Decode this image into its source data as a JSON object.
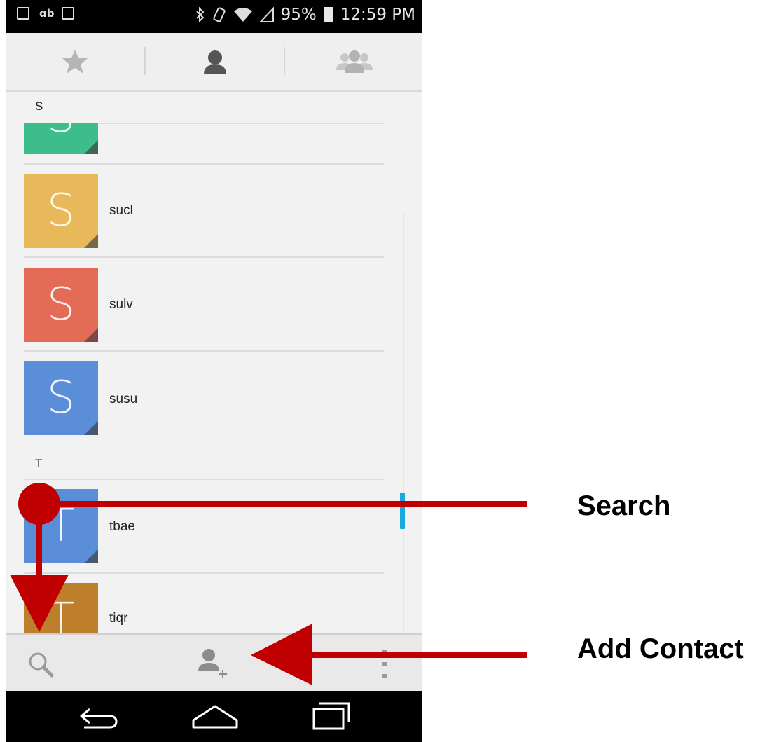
{
  "status_bar": {
    "battery_percent": "95%",
    "time": "12:59 PM",
    "left_icons": [
      "image-notification-icon",
      "dropbox-icon",
      "gmail-icon"
    ],
    "right_icons": [
      "bluetooth-icon",
      "rotation-icon",
      "wifi-icon",
      "signal-icon",
      "battery-icon"
    ]
  },
  "tabs": [
    {
      "id": "favorites",
      "icon": "star-icon",
      "selected": false
    },
    {
      "id": "contacts",
      "icon": "person-icon",
      "selected": true
    },
    {
      "id": "groups",
      "icon": "group-icon",
      "selected": false
    }
  ],
  "contacts": {
    "section_s": "S",
    "section_t": "T",
    "items": [
      {
        "name": "",
        "letter": "S",
        "color": "#3dbd8a"
      },
      {
        "name": "sucl",
        "letter": "S",
        "color": "#e8b95a"
      },
      {
        "name": "sulv",
        "letter": "S",
        "color": "#e46c57"
      },
      {
        "name": "susu",
        "letter": "S",
        "color": "#5b8ed8"
      },
      {
        "name": "tbae",
        "letter": "T",
        "color": "#5b8ed8"
      },
      {
        "name": "tiqr",
        "letter": "T",
        "color": "#bd7f2b"
      }
    ]
  },
  "bottom_bar": {
    "icons": [
      "search-icon",
      "add-contact-icon",
      "overflow-menu-icon"
    ]
  },
  "nav_bar": {
    "icons": [
      "back-icon",
      "home-icon",
      "recents-icon"
    ]
  },
  "annotations": {
    "search_label": "Search",
    "add_contact_label": "Add Contact",
    "color": "#c00000"
  }
}
